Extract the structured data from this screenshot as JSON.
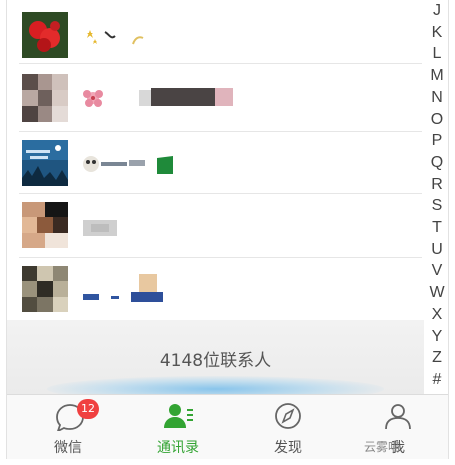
{
  "contacts": {
    "index_letters": [
      "J",
      "K",
      "L",
      "M",
      "N",
      "O",
      "P",
      "Q",
      "R",
      "S",
      "T",
      "U",
      "V",
      "W",
      "X",
      "Y",
      "Z",
      "#"
    ],
    "total_count": "4148位联系人"
  },
  "tabbar": {
    "items": [
      {
        "label": "微信",
        "icon": "chat-bubble-icon",
        "badge": "12"
      },
      {
        "label": "通讯录",
        "icon": "contacts-icon"
      },
      {
        "label": "发现",
        "icon": "compass-icon"
      },
      {
        "label": "我",
        "icon": "person-icon"
      }
    ],
    "active_color": "#33a433",
    "badge_color": "#f04040"
  },
  "watermark": {
    "text": "云雾喵"
  }
}
